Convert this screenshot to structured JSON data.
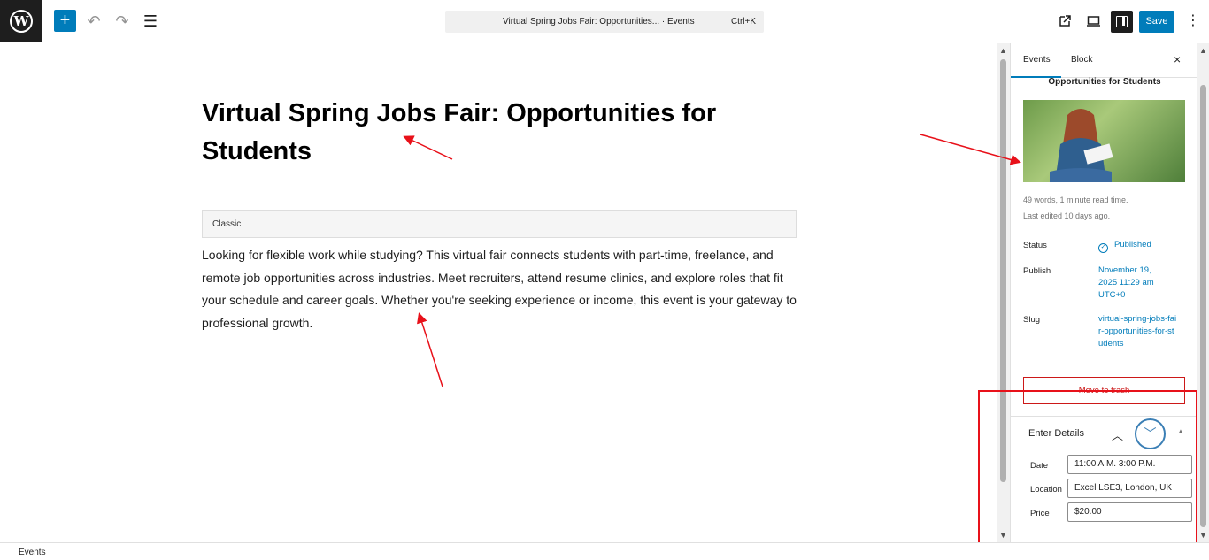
{
  "topbar": {
    "logo_letter": "W",
    "add_label": "+",
    "undo_icon": "↶",
    "redo_icon": "↷",
    "list_view_icon": "☰",
    "document_title": "Virtual Spring Jobs Fair: Opportunities... · Events",
    "command_shortcut": "Ctrl+K",
    "view_post_icon": "external-link-icon",
    "preview_icon": "desktop-icon",
    "save_label": "Save",
    "more_label": "⋮"
  },
  "editor": {
    "title": "Virtual Spring Jobs Fair: Opportunities for Students",
    "classic_block_label": "Classic",
    "content": "Looking for flexible work while studying? This virtual fair connects students with part-time, freelance, and remote job opportunities across industries. Meet recruiters, attend resume clinics, and explore roles that fit your schedule and career goals. Whether you're seeking experience or income, this event is your gateway to professional growth."
  },
  "sidebar": {
    "tabs": [
      {
        "label": "Events",
        "active": true
      },
      {
        "label": "Block",
        "active": false
      }
    ],
    "close_label": "×",
    "post_title": "Opportunities for Students",
    "meta_words": "49 words, 1 minute read time.",
    "meta_edited": "Last edited 10 days ago.",
    "status_label": "Status",
    "status_value": "Published",
    "publish_label": "Publish",
    "publish_value": "November 19, 2025 11:29 am UTC+0",
    "slug_label": "Slug",
    "slug_value": "virtual-spring-jobs-fair-opportunities-for-students",
    "trash_label": "Move to trash",
    "details": {
      "title": "Enter Details",
      "fields": [
        {
          "label": "Date",
          "value": "11:00 A.M.  3:00 P.M."
        },
        {
          "label": "Location",
          "value": "Excel LSE3, London, UK"
        },
        {
          "label": "Price",
          "value": "$20.00"
        }
      ]
    }
  },
  "footer": {
    "breadcrumb": "Events"
  },
  "colors": {
    "accent": "#007cba",
    "danger": "#cc1818",
    "annotation": "#e8111a"
  }
}
